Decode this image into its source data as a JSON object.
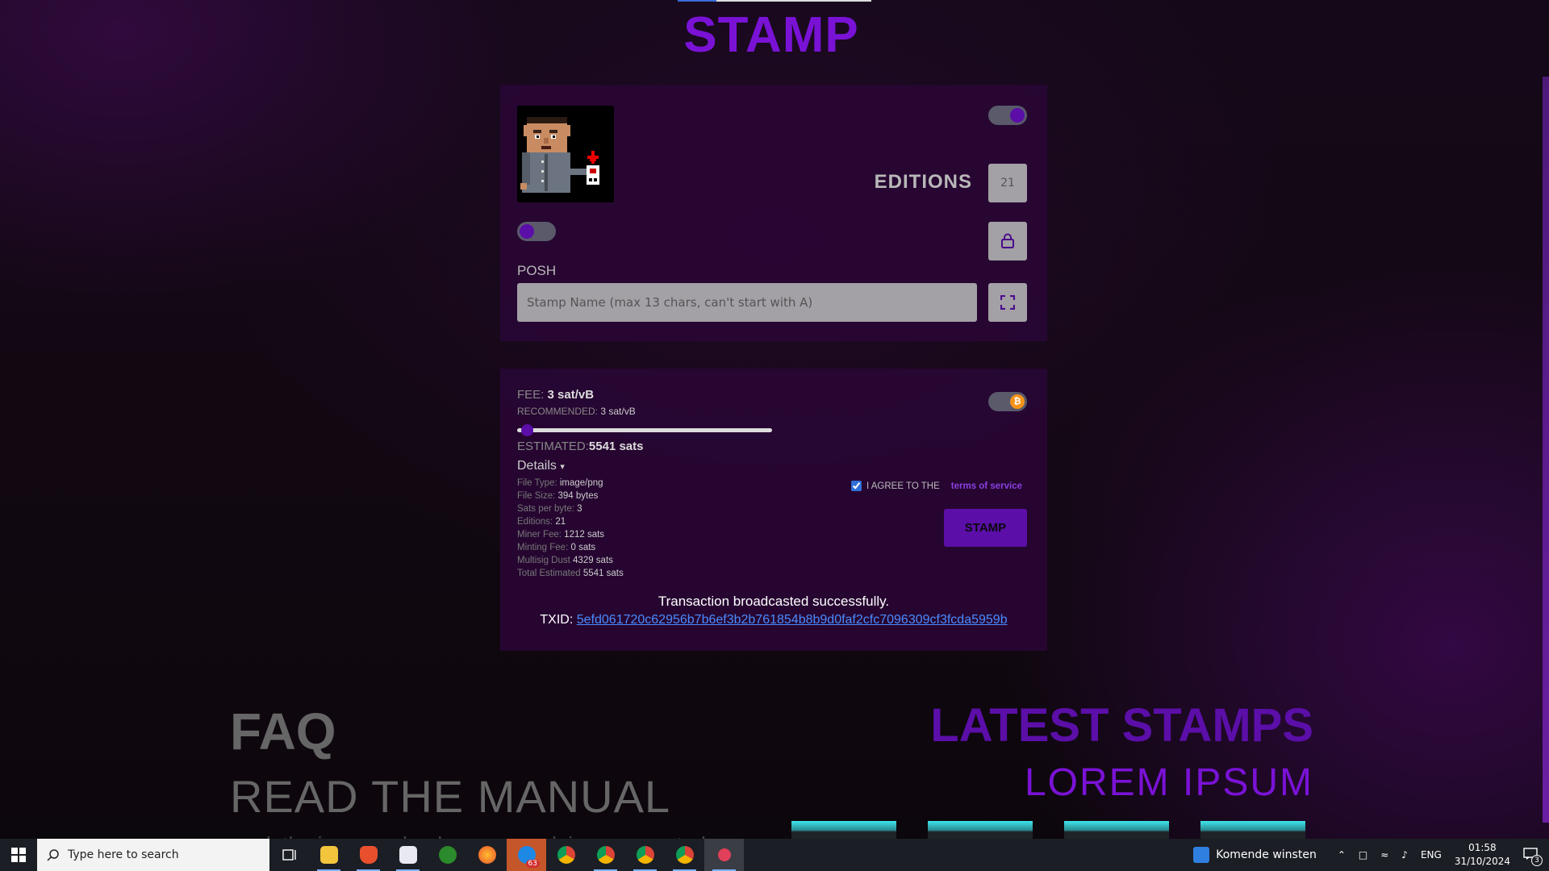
{
  "page": {
    "title": "STAMP"
  },
  "stamp_panel": {
    "editions_label": "EDITIONS",
    "editions_value": "21",
    "posh_label": "POSH",
    "name_placeholder": "Stamp Name (max 13 chars, can't start with A)"
  },
  "fee_panel": {
    "fee_label": "FEE:",
    "fee_value": "3 sat/vB",
    "recommended_label": "RECOMMENDED:",
    "recommended_value": "3 sat/vB",
    "slider_level": 0.01,
    "estimated_label": "ESTIMATED:",
    "estimated_value": "5541 sats",
    "details_label": "Details",
    "details": [
      {
        "label": "File Type:",
        "value": "image/png"
      },
      {
        "label": "File Size:",
        "value": "394 bytes"
      },
      {
        "label": "Sats per byte:",
        "value": "3"
      },
      {
        "label": "Editions:",
        "value": "21"
      },
      {
        "label": "Miner Fee:",
        "value": "1212 sats"
      },
      {
        "label": "Minting Fee:",
        "value": "0 sats"
      },
      {
        "label": "Multisig Dust",
        "value": "4329 sats"
      },
      {
        "label": "Total Estimated",
        "value": "5541 sats"
      }
    ],
    "tos_text": "I AGREE TO THE",
    "tos_link": "terms of service",
    "tos_checked": true,
    "stamp_button": "STAMP",
    "success_message": "Transaction broadcasted successfully.",
    "txid_label": "TXID:",
    "txid_value": "5efd061720c62956b7b6ef3b2b761854b8b9d0faf2cfc7096309cf3fcda5959b"
  },
  "faq": {
    "title": "FAQ",
    "subtitle": "READ THE MANUAL",
    "partial_text": "k the icon... upload your ... work is ... supported"
  },
  "latest": {
    "title": "LATEST STAMPS",
    "subtitle": "LOREM IPSUM"
  },
  "taskbar": {
    "search_placeholder": "Type here to search",
    "mail_badge": "63",
    "news_text": "Komende winsten",
    "language": "ENG",
    "time": "01:58",
    "date": "31/10/2024",
    "notification_count": "3"
  },
  "colors": {
    "accent_purple": "#5b0ea8",
    "title_purple": "#7a12d6",
    "panel_bg": "#28063a",
    "link_blue": "#4a8cff",
    "bitcoin_orange": "#f7931a"
  }
}
